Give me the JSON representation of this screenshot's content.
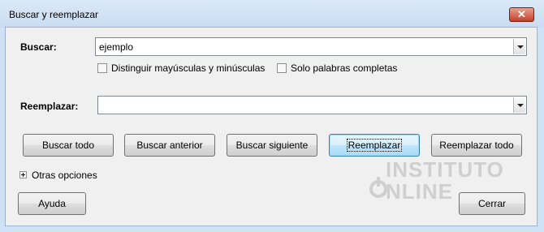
{
  "window": {
    "title": "Buscar y reemplazar",
    "close_icon": "✕"
  },
  "search": {
    "label": "Buscar:",
    "value": "ejemplo"
  },
  "options": {
    "match_case": {
      "label": "Distinguir mayúsculas y minúsculas",
      "checked": false
    },
    "whole_words": {
      "label": "Solo palabras completas",
      "checked": false
    }
  },
  "replace": {
    "label": "Reemplazar:",
    "value": ""
  },
  "buttons": {
    "find_all": "Buscar todo",
    "find_prev": "Buscar anterior",
    "find_next": "Buscar siguiente",
    "replace": "Reemplazar",
    "replace_all": "Reemplazar todo",
    "help": "Ayuda",
    "close": "Cerrar"
  },
  "more_options": {
    "label": "Otras opciones"
  },
  "watermark": {
    "line1": "INSTITUTO",
    "line2": "NLINE"
  }
}
